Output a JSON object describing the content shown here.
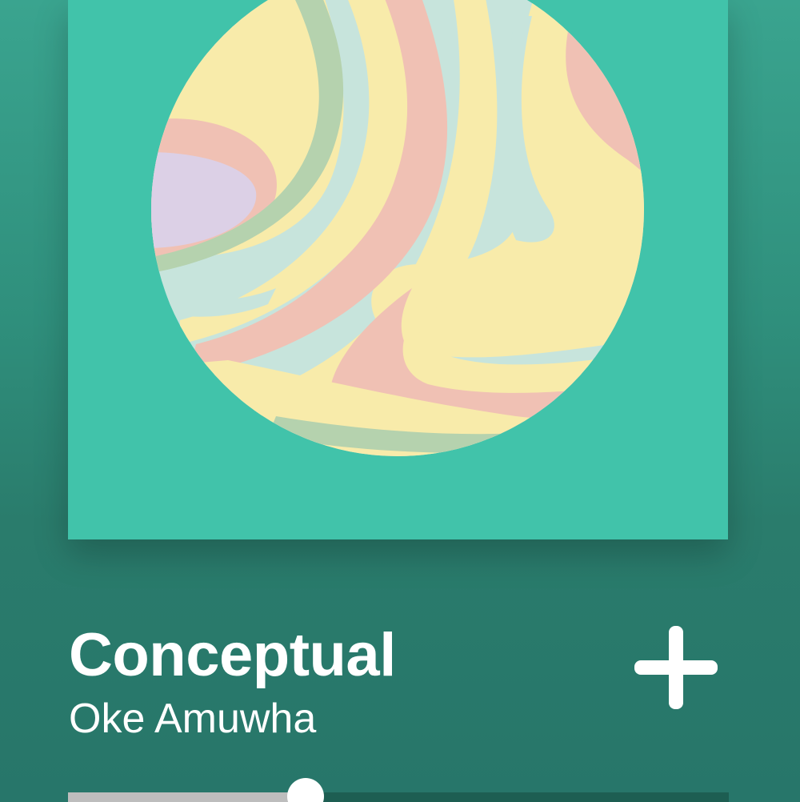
{
  "track": {
    "title": "Conceptual",
    "artist": "Oke Amuwha"
  },
  "artwork": {
    "background_color": "#41c3aa",
    "swirl_colors": [
      "#c7e4dc",
      "#f8ebaa",
      "#f0c1b4",
      "#b5d2ae",
      "#dcd0e6"
    ]
  },
  "controls": {
    "add_icon": "plus-icon"
  },
  "playback": {
    "progress_fraction": 0.359
  }
}
